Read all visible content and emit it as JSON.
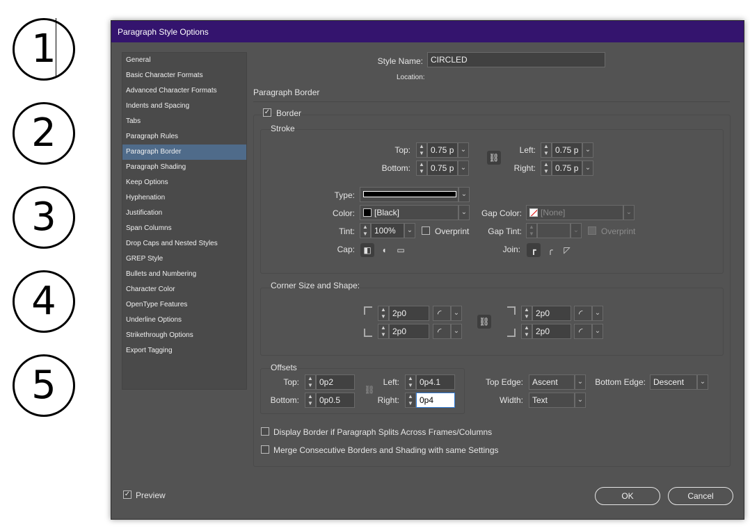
{
  "circled_numbers": [
    "1",
    "2",
    "3",
    "4",
    "5"
  ],
  "dialog": {
    "title": "Paragraph Style Options",
    "style_name_label": "Style Name:",
    "style_name_value": "CIRCLED",
    "location_label": "Location:",
    "section_title": "Paragraph Border"
  },
  "sidebar": {
    "items": [
      {
        "label": "General"
      },
      {
        "label": "Basic Character Formats"
      },
      {
        "label": "Advanced Character Formats"
      },
      {
        "label": "Indents and Spacing"
      },
      {
        "label": "Tabs"
      },
      {
        "label": "Paragraph Rules"
      },
      {
        "label": "Paragraph Border",
        "selected": true
      },
      {
        "label": "Paragraph Shading"
      },
      {
        "label": "Keep Options"
      },
      {
        "label": "Hyphenation"
      },
      {
        "label": "Justification"
      },
      {
        "label": "Span Columns"
      },
      {
        "label": "Drop Caps and Nested Styles"
      },
      {
        "label": "GREP Style"
      },
      {
        "label": "Bullets and Numbering"
      },
      {
        "label": "Character Color"
      },
      {
        "label": "OpenType Features"
      },
      {
        "label": "Underline Options"
      },
      {
        "label": "Strikethrough Options"
      },
      {
        "label": "Export Tagging"
      }
    ]
  },
  "border": {
    "checkbox_label": "Border",
    "checked": true,
    "stroke": {
      "title": "Stroke",
      "top_label": "Top:",
      "top_value": "0.75 p",
      "bottom_label": "Bottom:",
      "bottom_value": "0.75 p",
      "left_label": "Left:",
      "left_value": "0.75 p",
      "right_label": "Right:",
      "right_value": "0.75 p",
      "type_label": "Type:",
      "color_label": "Color:",
      "color_value": "[Black]",
      "gap_color_label": "Gap Color:",
      "gap_color_value": "[None]",
      "tint_label": "Tint:",
      "tint_value": "100%",
      "overprint_label": "Overprint",
      "gap_tint_label": "Gap Tint:",
      "gap_overprint_label": "Overprint",
      "cap_label": "Cap:",
      "join_label": "Join:"
    },
    "corner": {
      "title": "Corner Size and Shape:",
      "tl_value": "2p0",
      "bl_value": "2p0",
      "tr_value": "2p0",
      "br_value": "2p0"
    },
    "offsets": {
      "title": "Offsets",
      "top_label": "Top:",
      "top_value": "0p2",
      "bottom_label": "Bottom:",
      "bottom_value": "0p0.5",
      "left_label": "Left:",
      "left_value": "0p4.1",
      "right_label": "Right:",
      "right_value": "0p4",
      "top_edge_label": "Top Edge:",
      "top_edge_value": "Ascent",
      "bottom_edge_label": "Bottom Edge:",
      "bottom_edge_value": "Descent",
      "width_label": "Width:",
      "width_value": "Text"
    },
    "display_split_label": "Display Border if Paragraph Splits Across Frames/Columns",
    "merge_label": "Merge Consecutive Borders and Shading with same Settings"
  },
  "footer": {
    "preview_label": "Preview",
    "preview_checked": true,
    "ok_label": "OK",
    "cancel_label": "Cancel"
  },
  "colors": {
    "title_bar": "#34146e",
    "dialog_bg": "#535353",
    "selected_item": "#4f6b8a"
  }
}
